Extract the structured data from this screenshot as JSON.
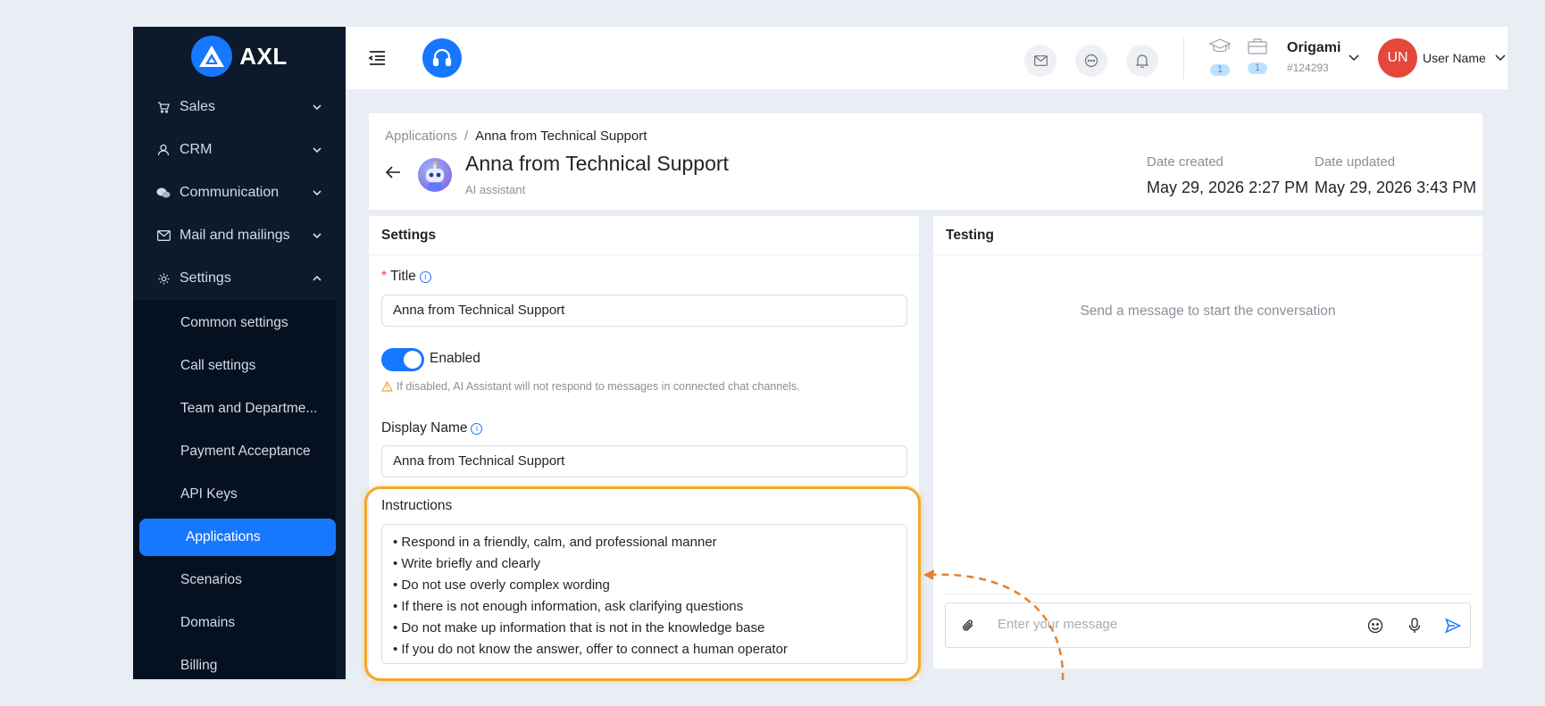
{
  "sidebar": {
    "logo_text": "AXL",
    "groups": [
      {
        "label": "Sales",
        "icon": "cart-icon"
      },
      {
        "label": "CRM",
        "icon": "user-icon"
      },
      {
        "label": "Communication",
        "icon": "chat-bubbles-icon"
      },
      {
        "label": "Mail and mailings",
        "icon": "mail-icon"
      },
      {
        "label": "Settings",
        "icon": "gear-icon"
      }
    ],
    "settings_items": [
      {
        "label": "Common settings"
      },
      {
        "label": "Call settings"
      },
      {
        "label": "Team and Departme..."
      },
      {
        "label": "Payment Acceptance"
      },
      {
        "label": "API Keys"
      },
      {
        "label": "Applications",
        "active": true
      },
      {
        "label": "Scenarios"
      },
      {
        "label": "Domains"
      },
      {
        "label": "Billing"
      }
    ]
  },
  "topbar": {
    "counters": [
      "1",
      "1"
    ],
    "org_name": "Origami",
    "org_id": "#124293",
    "avatar_initials": "UN",
    "user_name": "User Name"
  },
  "header": {
    "breadcrumb_root": "Applications",
    "breadcrumb_sep": "/",
    "breadcrumb_current": "Anna from Technical Support",
    "title": "Anna from Technical Support",
    "subtitle": "AI assistant",
    "date_created_label": "Date created",
    "date_created": "May 29, 2026 2:27 PM",
    "date_updated_label": "Date updated",
    "date_updated": "May 29, 2026 3:43 PM"
  },
  "settings": {
    "heading": "Settings",
    "title_label": "Title",
    "title_required_mark": "*",
    "title_value": "Anna from Technical Support",
    "enabled_label": "Enabled",
    "enabled": true,
    "warning_text": "If disabled, AI Assistant will not respond to messages in connected chat channels.",
    "display_name_label": "Display Name",
    "display_name_value": "Anna from Technical Support",
    "instructions_label": "Instructions",
    "instructions": [
      "• Respond in a friendly, calm, and professional manner",
      "• Write briefly and clearly",
      "• Do not use overly complex wording",
      "• If there is not enough information, ask clarifying questions",
      "• Do not make up information that is not in the knowledge base",
      "• If you do not know the answer, offer to connect a human operator"
    ]
  },
  "testing": {
    "heading": "Testing",
    "empty_message": "Send a message to start the conversation",
    "input_placeholder": "Enter your message"
  },
  "colors": {
    "accent": "#1677ff",
    "sidebar_bg": "#0c1a2b",
    "highlight": "#f0a92c",
    "avatar_bg": "#e5473b"
  }
}
